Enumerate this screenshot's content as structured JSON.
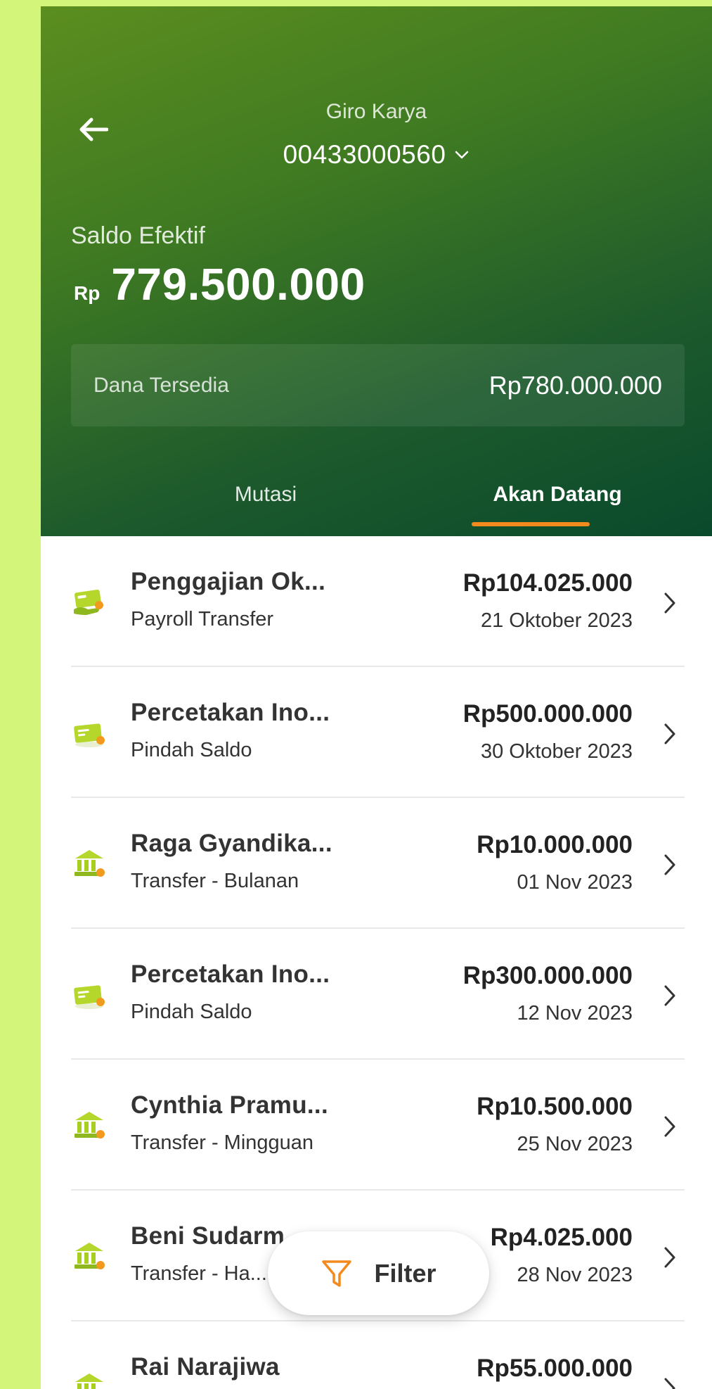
{
  "header": {
    "account_name": "Giro Karya",
    "account_number": "00433000560",
    "balance_label": "Saldo Efektif",
    "balance_currency": "Rp",
    "balance_value": "779.500.000",
    "available_label": "Dana Tersedia",
    "available_value": "Rp780.000.000"
  },
  "tabs": [
    {
      "label": "Mutasi",
      "active": false
    },
    {
      "label": "Akan Datang",
      "active": true
    }
  ],
  "transactions": [
    {
      "title": "Penggajian Ok...",
      "subtitle": "Payroll Transfer",
      "amount": "Rp104.025.000",
      "date": "21 Oktober 2023",
      "icon": "payroll-icon"
    },
    {
      "title": "Percetakan Ino...",
      "subtitle": "Pindah Saldo",
      "amount": "Rp500.000.000",
      "date": "30 Oktober 2023",
      "icon": "card-transfer-icon"
    },
    {
      "title": "Raga Gyandika...",
      "subtitle": "Transfer - Bulanan",
      "amount": "Rp10.000.000",
      "date": "01 Nov 2023",
      "icon": "bank-icon"
    },
    {
      "title": "Percetakan Ino...",
      "subtitle": "Pindah Saldo",
      "amount": "Rp300.000.000",
      "date": "12 Nov 2023",
      "icon": "card-transfer-icon"
    },
    {
      "title": "Cynthia Pramu...",
      "subtitle": "Transfer - Mingguan",
      "amount": "Rp10.500.000",
      "date": "25 Nov 2023",
      "icon": "bank-icon"
    },
    {
      "title": "Beni Sudarm...",
      "subtitle": "Transfer - Ha...",
      "amount": "Rp4.025.000",
      "date": "28 Nov 2023",
      "icon": "bank-icon"
    },
    {
      "title": "Rai Narajiwa",
      "subtitle": "",
      "amount": "Rp55.000.000",
      "date": "",
      "icon": "bank-icon"
    }
  ],
  "filter": {
    "label": "Filter"
  },
  "colors": {
    "accent": "#f28a1e",
    "header_dark": "#0a4a2c",
    "icon_green": "#a8cf1f"
  }
}
